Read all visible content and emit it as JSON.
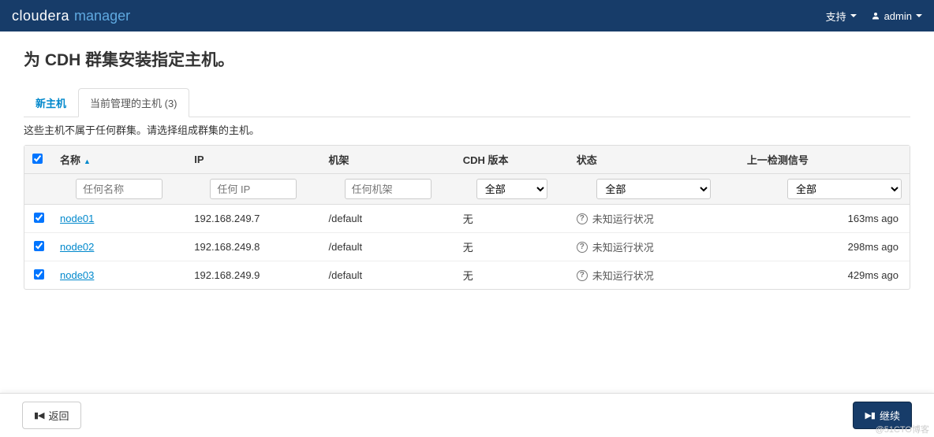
{
  "navbar": {
    "brand_a": "cloudera",
    "brand_b": "manager",
    "support": "支持",
    "user": "admin"
  },
  "page": {
    "title": "为 CDH 群集安装指定主机。",
    "help": "这些主机不属于任何群集。请选择组成群集的主机。"
  },
  "tabs": {
    "new": "新主机",
    "current": "当前管理的主机 (3)"
  },
  "table": {
    "headers": {
      "name": "名称",
      "ip": "IP",
      "rack": "机架",
      "cdh": "CDH 版本",
      "status": "状态",
      "last": "上一检测信号"
    },
    "filters": {
      "name_ph": "任何名称",
      "ip_ph": "任何 IP",
      "rack_ph": "任何机架",
      "all": "全部"
    },
    "rows": [
      {
        "name": "node01",
        "ip": "192.168.249.7",
        "rack": "/default",
        "cdh": "无",
        "status": "未知运行状况",
        "last": "163ms ago"
      },
      {
        "name": "node02",
        "ip": "192.168.249.8",
        "rack": "/default",
        "cdh": "无",
        "status": "未知运行状况",
        "last": "298ms ago"
      },
      {
        "name": "node03",
        "ip": "192.168.249.9",
        "rack": "/default",
        "cdh": "无",
        "status": "未知运行状况",
        "last": "429ms ago"
      }
    ]
  },
  "footer": {
    "back": "返回",
    "continue": "继续"
  },
  "watermark": "@51CTO博客"
}
